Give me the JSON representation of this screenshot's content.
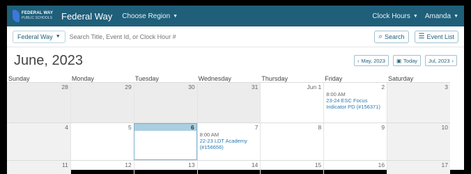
{
  "nav": {
    "logo_line1": "FEDERAL WAY",
    "logo_line2": "PUBLIC SCHOOLS",
    "brand": "Federal Way",
    "region": "Choose Region",
    "clock_hours": "Clock Hours",
    "user": "Amanda"
  },
  "search": {
    "district": "Federal Way",
    "placeholder": "Search Title, Event Id, or Clock Hour #",
    "search_label": "Search",
    "event_list_label": "Event List"
  },
  "calendar": {
    "title": "June, 2023",
    "prev_label": "May, 2023",
    "today_label": "Today",
    "next_label": "Jul, 2023",
    "days_of_week": [
      "Sunday",
      "Monday",
      "Tuesday",
      "Wednesday",
      "Thursday",
      "Friday",
      "Saturday"
    ],
    "weeks": [
      [
        {
          "num": "28",
          "other": true
        },
        {
          "num": "29",
          "other": true
        },
        {
          "num": "30",
          "other": true
        },
        {
          "num": "31",
          "other": true
        },
        {
          "num": "Jun 1"
        },
        {
          "num": "2",
          "events": [
            {
              "time": "8:00 AM",
              "title": "23-24 ESC Focus Indicator PD (#156371)"
            }
          ]
        },
        {
          "num": "3",
          "shade": true
        }
      ],
      [
        {
          "num": "4",
          "shade": true
        },
        {
          "num": "5"
        },
        {
          "num": "6",
          "today": true
        },
        {
          "num": "7",
          "events": [
            {
              "time": "8:00 AM",
              "title": "22-23 LDT Academy (#156656)"
            }
          ]
        },
        {
          "num": "8"
        },
        {
          "num": "9"
        },
        {
          "num": "10",
          "shade": true
        }
      ],
      [
        {
          "num": "11",
          "shade": true
        },
        {
          "num": "12"
        },
        {
          "num": "13"
        },
        {
          "num": "14"
        },
        {
          "num": "15"
        },
        {
          "num": "16"
        },
        {
          "num": "17",
          "shade": true
        }
      ]
    ]
  }
}
